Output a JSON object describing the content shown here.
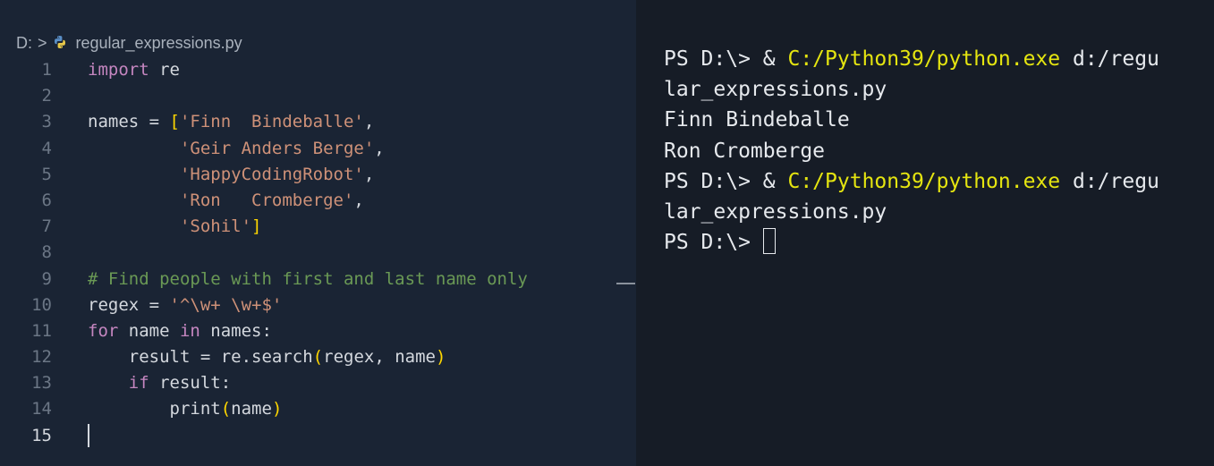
{
  "breadcrumb": {
    "drive": "D:",
    "separator": ">",
    "file_icon": "python-icon",
    "file": "regular_expressions.py"
  },
  "editor": {
    "active_line": 15,
    "lines": [
      {
        "n": "1",
        "tokens": [
          {
            "t": "import",
            "c": "kw"
          },
          {
            "t": " re",
            "c": ""
          }
        ]
      },
      {
        "n": "2",
        "tokens": []
      },
      {
        "n": "3",
        "tokens": [
          {
            "t": "names = ",
            "c": ""
          },
          {
            "t": "[",
            "c": "br"
          },
          {
            "t": "'Finn  Bindeballe'",
            "c": "str"
          },
          {
            "t": ",",
            "c": ""
          }
        ]
      },
      {
        "n": "4",
        "tokens": [
          {
            "t": "         ",
            "c": ""
          },
          {
            "t": "'Geir Anders Berge'",
            "c": "str"
          },
          {
            "t": ",",
            "c": ""
          }
        ]
      },
      {
        "n": "5",
        "tokens": [
          {
            "t": "         ",
            "c": ""
          },
          {
            "t": "'HappyCodingRobot'",
            "c": "str"
          },
          {
            "t": ",",
            "c": ""
          }
        ]
      },
      {
        "n": "6",
        "tokens": [
          {
            "t": "         ",
            "c": ""
          },
          {
            "t": "'Ron   Cromberge'",
            "c": "str"
          },
          {
            "t": ",",
            "c": ""
          }
        ]
      },
      {
        "n": "7",
        "tokens": [
          {
            "t": "         ",
            "c": ""
          },
          {
            "t": "'Sohil'",
            "c": "str"
          },
          {
            "t": "]",
            "c": "br"
          }
        ]
      },
      {
        "n": "8",
        "tokens": []
      },
      {
        "n": "9",
        "tokens": [
          {
            "t": "# Find people with first and last name only",
            "c": "cmt"
          }
        ]
      },
      {
        "n": "10",
        "tokens": [
          {
            "t": "regex = ",
            "c": ""
          },
          {
            "t": "'^\\w+ \\w+$'",
            "c": "str"
          }
        ]
      },
      {
        "n": "11",
        "tokens": [
          {
            "t": "for",
            "c": "kw"
          },
          {
            "t": " name ",
            "c": ""
          },
          {
            "t": "in",
            "c": "kw"
          },
          {
            "t": " names:",
            "c": ""
          }
        ]
      },
      {
        "n": "12",
        "tokens": [
          {
            "t": "    result = re.search",
            "c": ""
          },
          {
            "t": "(",
            "c": "br"
          },
          {
            "t": "regex, name",
            "c": ""
          },
          {
            "t": ")",
            "c": "br"
          }
        ]
      },
      {
        "n": "13",
        "tokens": [
          {
            "t": "    ",
            "c": ""
          },
          {
            "t": "if",
            "c": "kw"
          },
          {
            "t": " result:",
            "c": ""
          }
        ]
      },
      {
        "n": "14",
        "tokens": [
          {
            "t": "        print",
            "c": ""
          },
          {
            "t": "(",
            "c": "br"
          },
          {
            "t": "name",
            "c": ""
          },
          {
            "t": ")",
            "c": "br"
          }
        ]
      },
      {
        "n": "15",
        "tokens": [],
        "cursor": true
      }
    ]
  },
  "terminal": {
    "lines": [
      {
        "parts": [
          {
            "t": "PS D:\\> & ",
            "c": ""
          },
          {
            "t": "C:/Python39/python.exe",
            "c": "exe"
          },
          {
            "t": " d:/regu",
            "c": ""
          }
        ]
      },
      {
        "parts": [
          {
            "t": "lar_expressions.py",
            "c": ""
          }
        ]
      },
      {
        "parts": [
          {
            "t": "Finn Bindeballe",
            "c": ""
          }
        ]
      },
      {
        "parts": [
          {
            "t": "Ron Cromberge",
            "c": ""
          }
        ]
      },
      {
        "parts": [
          {
            "t": "PS D:\\> & ",
            "c": ""
          },
          {
            "t": "C:/Python39/python.exe",
            "c": "exe"
          },
          {
            "t": " d:/regu",
            "c": ""
          }
        ]
      },
      {
        "parts": [
          {
            "t": "lar_expressions.py",
            "c": ""
          }
        ]
      },
      {
        "parts": [
          {
            "t": "PS D:\\> ",
            "c": ""
          }
        ],
        "cursor": true
      }
    ]
  },
  "colors": {
    "keyword": "#c586c0",
    "string": "#ce9178",
    "comment": "#6a9955",
    "bracket": "#ffd700",
    "terminal_exe": "#e5e510"
  }
}
